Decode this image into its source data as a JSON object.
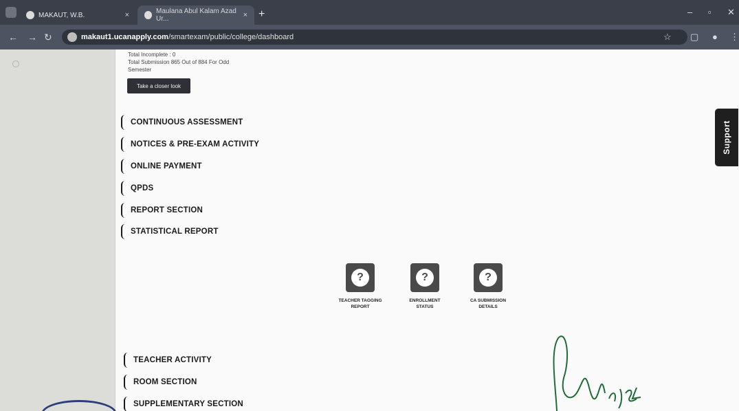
{
  "browser": {
    "tabs": [
      {
        "title": "MAKAUT, W.B.",
        "close": "×"
      },
      {
        "title": "Maulana Abul Kalam Azad Ur...",
        "close": "×"
      }
    ],
    "new_tab": "+",
    "url_host": "makaut1.ucanapply.com",
    "url_path": "/smartexam/public/college/dashboard"
  },
  "summary": {
    "line1": "Total Incomplete : 0",
    "line2": "Total Submission 865 Out of 884 For Odd",
    "line3": "Semester",
    "link_button": "Take a closer look"
  },
  "sections": [
    {
      "label": "CONTINUOUS ASSESSMENT"
    },
    {
      "label": "NOTICES & PRE-EXAM ACTIVITY"
    },
    {
      "label": "ONLINE PAYMENT"
    },
    {
      "label": "QPDS"
    },
    {
      "label": "REPORT SECTION"
    },
    {
      "label": "STATISTICAL REPORT"
    }
  ],
  "tiles": [
    {
      "label": "TEACHER TAGGING\nREPORT",
      "icon": "question-bubble-icon"
    },
    {
      "label": "ENROLLMENT\nSTATUS",
      "icon": "question-bubble-icon"
    },
    {
      "label": "CA SUBMISSION\nDETAILS",
      "icon": "question-bubble-icon"
    }
  ],
  "sections_bottom": [
    {
      "label": "TEACHER ACTIVITY"
    },
    {
      "label": "ROOM SECTION"
    },
    {
      "label": "SUPPLEMENTARY SECTION"
    }
  ],
  "support_label": "Support",
  "tile_glyph": "?"
}
